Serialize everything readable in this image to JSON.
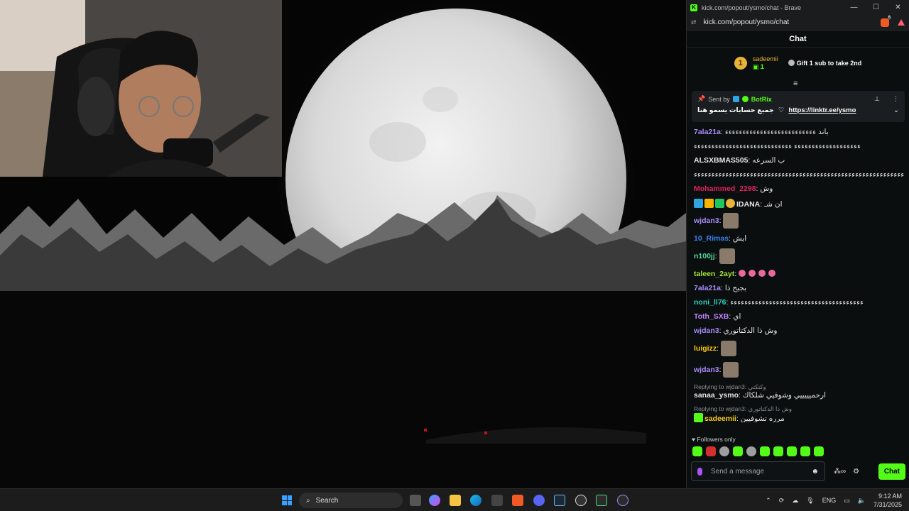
{
  "window": {
    "title": "kick.com/popout/ysmo/chat - Brave",
    "url": "kick.com/popout/ysmo/chat",
    "brave_badge": "6"
  },
  "chat": {
    "header": "Chat",
    "leaderboard": {
      "rank": "1",
      "username": "sadeemii",
      "count": "1",
      "gift_text": "Gift 1 sub to take 2nd"
    },
    "pinned": {
      "sent_by": "Sent by",
      "bot_name": "BotRix",
      "text": "جميع حسابات يسمو هنا",
      "link": "https://linktr.ee/ysmo"
    },
    "messages": [
      {
        "user": "7ala21a",
        "color": "#a78bfa",
        "text": "باند ءءءءءءءءءءءءءءءءءءءءءءءءءء"
      },
      {
        "user": "",
        "color": "#e5e5e5",
        "text": "ءءءءءءءءءءءءءءءءءءء ءءءءءءءءءءءءءءءءءءءءءءءءءءءء"
      },
      {
        "user": "ALSXBMAS505",
        "color": "#e5e5e5",
        "text": "ب السرعه"
      },
      {
        "user": "",
        "color": "#e5e5e5",
        "text": "ءءءءءءءءءءءءءءءءءءءءءءءءءءءءءءءءءءءءءءءءءءءءءءءءءءءءءءءءءءءءء"
      },
      {
        "user": "Mohammed_2298",
        "color": "#e0245e",
        "text": "وش"
      },
      {
        "user": "IDANA",
        "color": "#e5e5e5",
        "text": "ان شـ",
        "badges": true
      },
      {
        "user": "wjdan3",
        "color": "#a78bfa",
        "text": "",
        "emote": true
      },
      {
        "user": "10_Rimas",
        "color": "#3b82f6",
        "text": "ايش"
      },
      {
        "user": "n100jj",
        "color": "#53d8a0",
        "text": "",
        "emote": true
      },
      {
        "user": "taleen_2ayt",
        "color": "#a3e635",
        "text": "",
        "dots": true
      },
      {
        "user": "7ala21a",
        "color": "#a78bfa",
        "text": "بجيح ذا"
      },
      {
        "user": "noni_ll76",
        "color": "#2dd4bf",
        "text": "ءءءءءءءءءءءءءءءءءءءءءءءءءءءءءءءءءءءءءء"
      },
      {
        "user": "Toth_SXB",
        "color": "#c084fc",
        "text": "اي"
      },
      {
        "user": "wjdan3",
        "color": "#a78bfa",
        "text": "وش ذا الدكتاتوري"
      },
      {
        "user": "luigizz",
        "color": "#facc15",
        "text": "",
        "emote": true
      },
      {
        "user": "wjdan3",
        "color": "#a78bfa",
        "text": "",
        "emote": true
      },
      {
        "reply": "Replying to wjdan3: وكتكتي",
        "user": "sanaa_ysmo",
        "color": "#e5e5e5",
        "text": "ارحميييييي وشوفيي شلكاك"
      },
      {
        "reply": "Replying to wjdan3: وش ذا الدكتاتوري",
        "user": "sadeemii",
        "color": "#facc15",
        "text": "مرره تشوفيين",
        "badge": true
      }
    ],
    "followers_only": "Followers only",
    "input_placeholder": "Send a message",
    "send_label": "Chat"
  },
  "taskbar": {
    "search_label": "Search",
    "lang": "ENG",
    "time": "9:12 AM",
    "date": "7/31/2025"
  }
}
